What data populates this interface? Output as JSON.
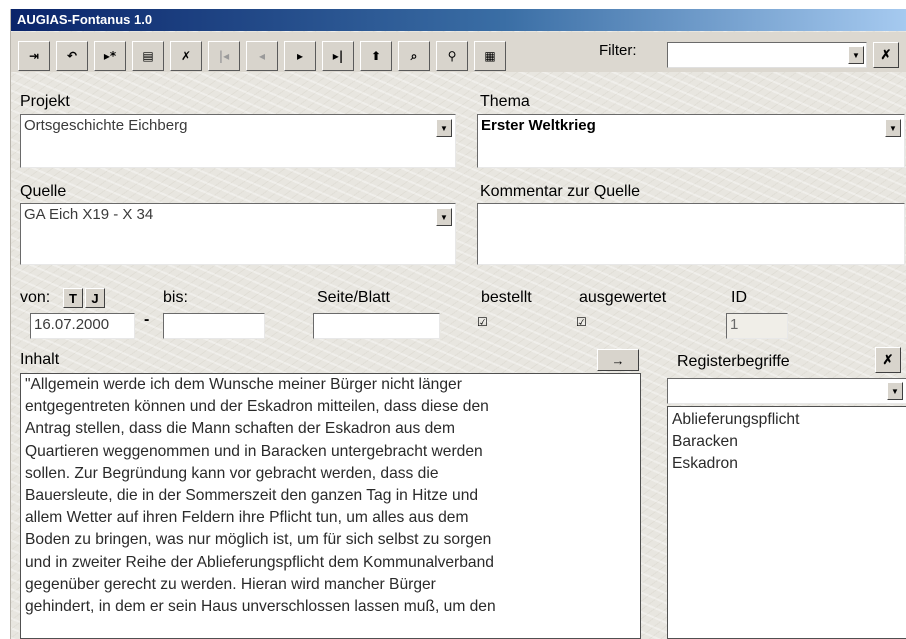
{
  "window": {
    "title": "AUGIAS-Fontanus 1.0"
  },
  "toolbar": {
    "buttons": [
      {
        "name": "exit-icon",
        "glyph": "⇥",
        "disabled": false
      },
      {
        "name": "undo-icon",
        "glyph": "↶",
        "disabled": false
      },
      {
        "name": "new-record-icon",
        "glyph": "▸*",
        "disabled": false
      },
      {
        "name": "save-icon",
        "glyph": "▤",
        "disabled": false
      },
      {
        "name": "delete-icon",
        "glyph": "✗",
        "disabled": false
      },
      {
        "name": "first-record-icon",
        "glyph": "|◂",
        "disabled": true
      },
      {
        "name": "previous-record-icon",
        "glyph": "◂",
        "disabled": true
      },
      {
        "name": "next-record-icon",
        "glyph": "▸",
        "disabled": false
      },
      {
        "name": "last-record-icon",
        "glyph": "▸|",
        "disabled": false
      },
      {
        "name": "up-arrow-icon",
        "glyph": "⬆",
        "disabled": false
      },
      {
        "name": "search-icon",
        "glyph": "⌕",
        "disabled": false
      },
      {
        "name": "binoculars-icon",
        "glyph": "⚲",
        "disabled": false
      },
      {
        "name": "calculator-icon",
        "glyph": "▦",
        "disabled": false
      }
    ],
    "filter_label": "Filter:",
    "filter_value": ""
  },
  "form": {
    "projekt_label": "Projekt",
    "projekt_value": "Ortsgeschichte Eichberg",
    "thema_label": "Thema",
    "thema_value": "Erster Weltkrieg",
    "quelle_label": "Quelle",
    "quelle_value": "GA Eich X19 - X 34",
    "kommentar_label": "Kommentar zur Quelle",
    "kommentar_value": "",
    "von_label": "von:",
    "t_button": "T",
    "j_button": "J",
    "bis_label": "bis:",
    "von_value": "16.07.2000",
    "dash": "-",
    "bis_value": "",
    "seite_label": "Seite/Blatt",
    "seite_value": "",
    "bestellt_label": "bestellt",
    "bestellt_checked": true,
    "ausgewertet_label": "ausgewertet",
    "ausgewertet_checked": true,
    "id_label": "ID",
    "id_value": "1",
    "inhalt_label": "Inhalt",
    "arrow_button": "→",
    "inhalt_lines": [
      "\"Allgemein werde ich dem Wunsche meiner Bürger nicht länger",
      "entgegentreten können und der Eskadron mitteilen, dass diese den",
      "Antrag stellen, dass die Mann schaften der Eskadron aus dem",
      "Quartieren weggenommen und in Baracken untergebracht werden",
      "sollen. Zur Begründung kann vor gebracht werden, dass die",
      "Bauersleute, die in der Sommerszeit den ganzen Tag in Hitze und",
      "allem Wetter auf ihren Feldern ihre Pflicht tun, um alles aus dem",
      "Boden zu bringen, was nur möglich ist, um für sich selbst zu sorgen",
      "und in zweiter Reihe der Ablieferungspflicht dem Kommunalverband",
      "gegenüber gerecht zu werden. Hieran wird mancher Bürger",
      "gehindert, in dem er sein Haus unverschlossen lassen muß, um den"
    ],
    "register_label": "Registerbegriffe",
    "register_items": [
      "Ablieferungspflicht",
      "Baracken",
      "Eskadron"
    ]
  }
}
